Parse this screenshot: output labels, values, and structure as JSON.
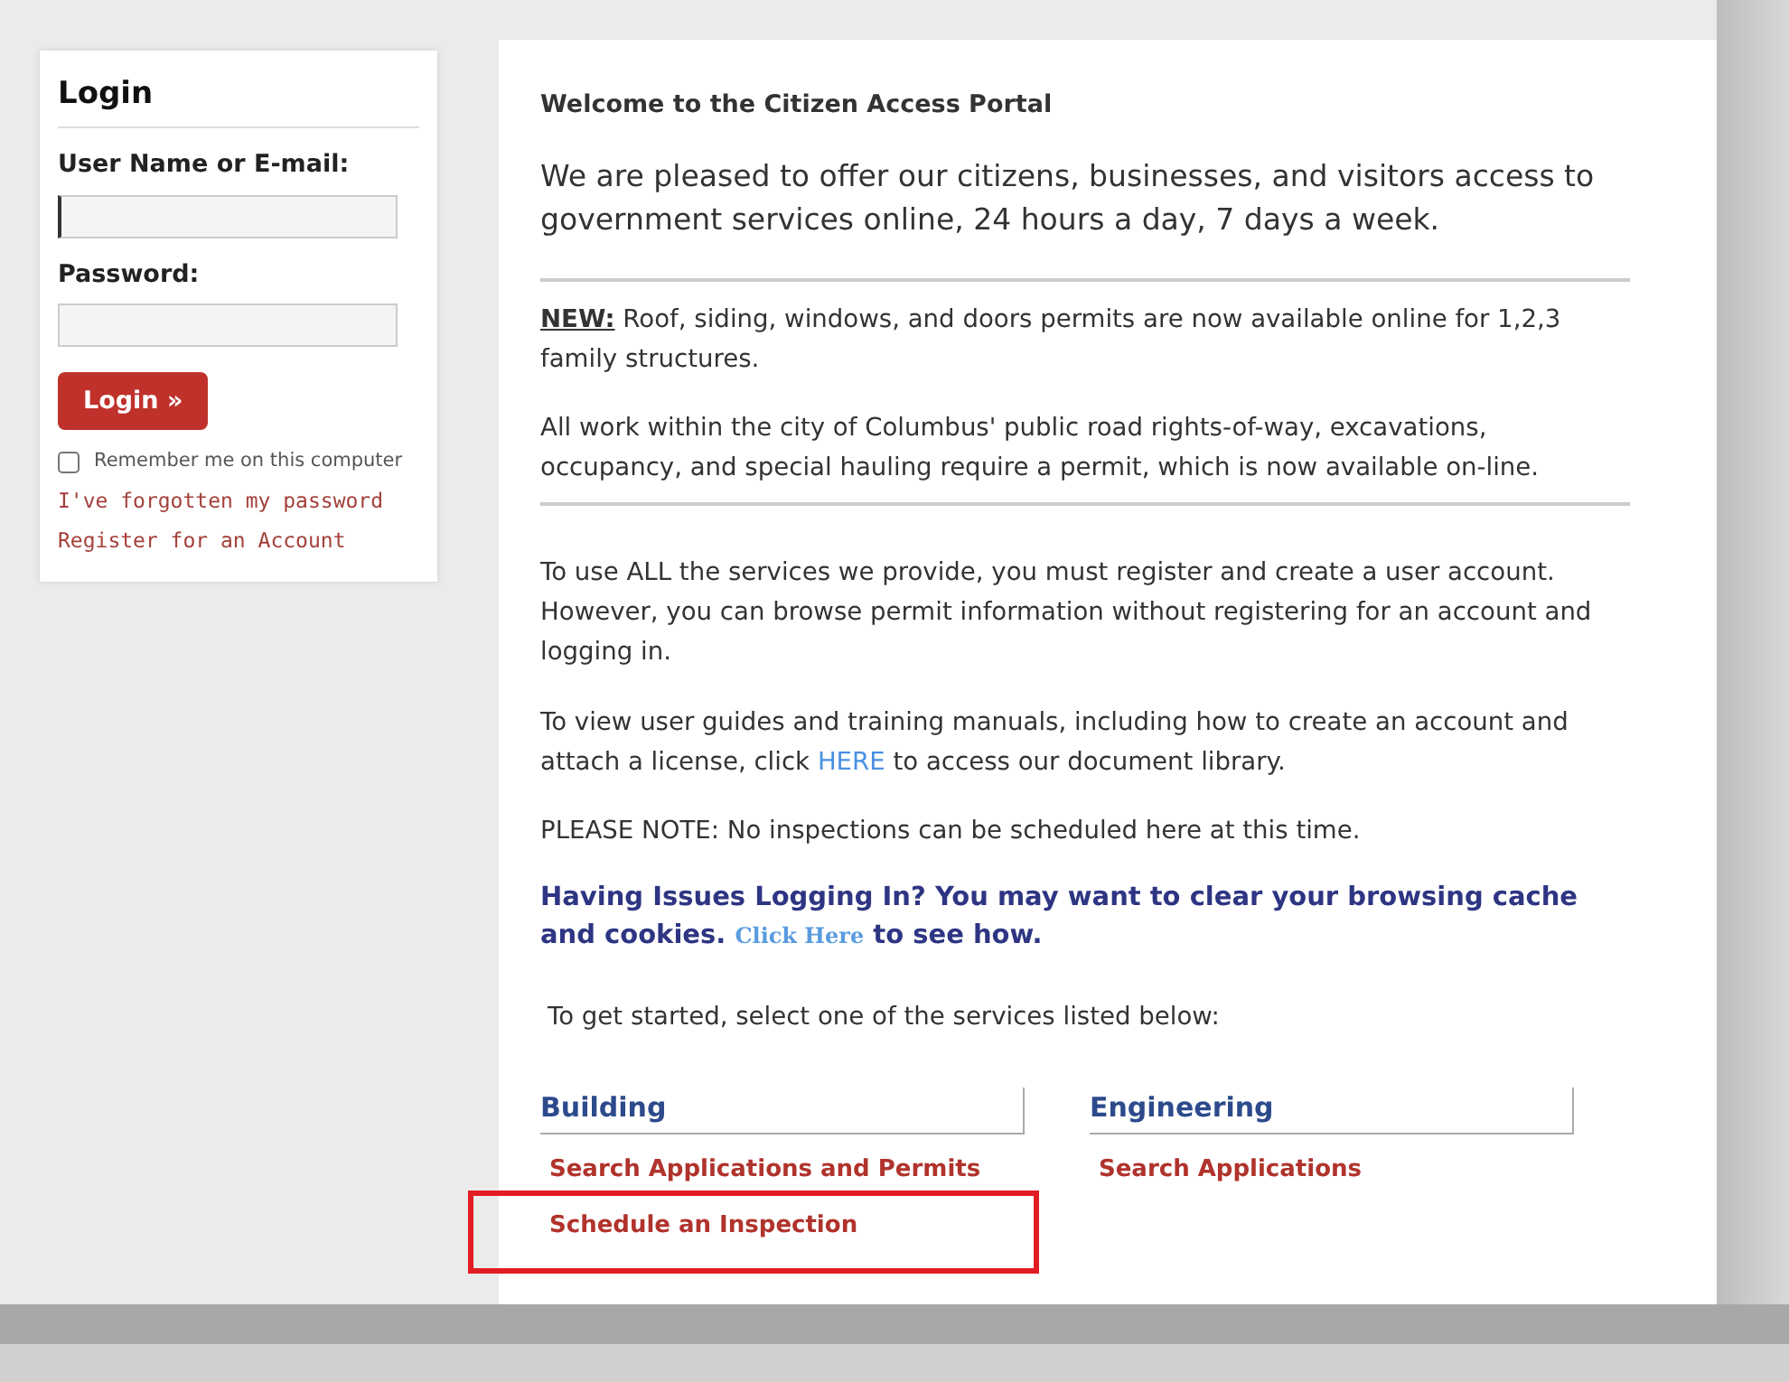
{
  "login": {
    "title": "Login",
    "username": {
      "label": "User Name or E-mail:",
      "focused": true
    },
    "password": {
      "label": "Password:"
    },
    "button": "Login »",
    "remember": {
      "label": "Remember me on this computer",
      "checked": false
    },
    "links": [
      "I've forgotten my password",
      "Register for an Account"
    ]
  },
  "main": {
    "title": "Welcome to the Citizen Access Portal",
    "intro": "We are pleased to offer our citizens, businesses, and visitors access to government services online, 24 hours a day, 7 days a week.",
    "notices": [
      "**NEW:** Roof, siding, windows, and doors permits are now available online for 1,2,3 family structures.",
      "All work within the city of Columbus' public road rights-of-way, excavations, occupancy, and special hauling require a permit, which is now available on-line."
    ],
    "info": "To use ALL the services we provide, you must register and create a user account. However, you can browse permit information without registering for an account and logging in.",
    "guides": {
      "before": "To view user guides and training manuals, including how to create an account and attach a license, click",
      "link": "HERE",
      "after": "to access our document library."
    },
    "note": "PLEASE NOTE: No inspections can be scheduled here at this time.",
    "issues": {
      "before": "Having Issues Logging In? You may want to clear your browsing cache and cookies.",
      "link": "Click Here",
      "after": "to see how."
    },
    "get_started": "To get started, select one of the services listed below:",
    "services": [
      {
        "title": "Building",
        "links": [
          {
            "label": "Search Applications and Permits",
            "highlighted": false
          },
          {
            "label": "Schedule an Inspection",
            "highlighted": true
          }
        ]
      },
      {
        "title": "Engineering",
        "links": [
          {
            "label": "Search Applications",
            "highlighted": false
          }
        ]
      }
    ]
  }
}
